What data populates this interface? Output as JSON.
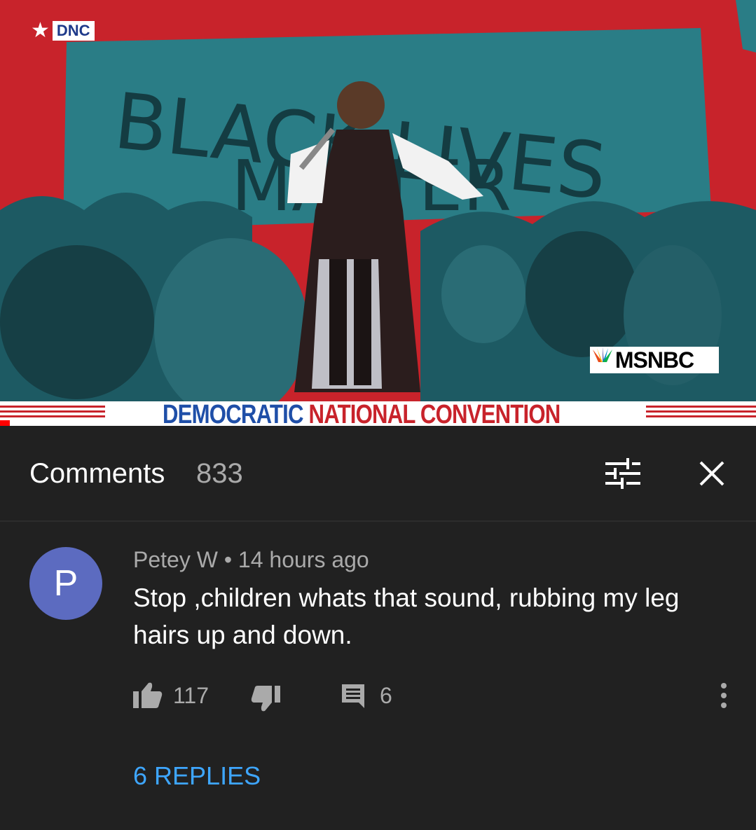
{
  "video": {
    "banner_text_top": "BLACK LIVES",
    "banner_text_bottom": "MATTER",
    "dnc_logo": "DNC",
    "network_logo": "MSNBC",
    "convention_word1": "DEMOCRATIC",
    "convention_word2": "NATIONAL CONVENTION",
    "progress": 0.013,
    "colors": {
      "background": "#c8232b",
      "banner": "#2a7d86",
      "crowd": "#1d5a63"
    }
  },
  "comments_header": {
    "title": "Comments",
    "count": "833",
    "filter_icon": "sort-filter-icon",
    "close_icon": "close-icon"
  },
  "comment": {
    "avatar_letter": "P",
    "author": "Petey W",
    "separator": " • ",
    "time": "14 hours ago",
    "text": "Stop ,children whats that sound, rubbing my leg hairs up and down.",
    "likes": "117",
    "reply_count": "6",
    "replies_label": "6 REPLIES",
    "icons": [
      "thumbs-up-icon",
      "thumbs-down-icon",
      "reply-icon",
      "more-vert-icon"
    ],
    "colors": {
      "avatar": "#5c6bc0",
      "replies_link": "#3ea6ff"
    }
  }
}
